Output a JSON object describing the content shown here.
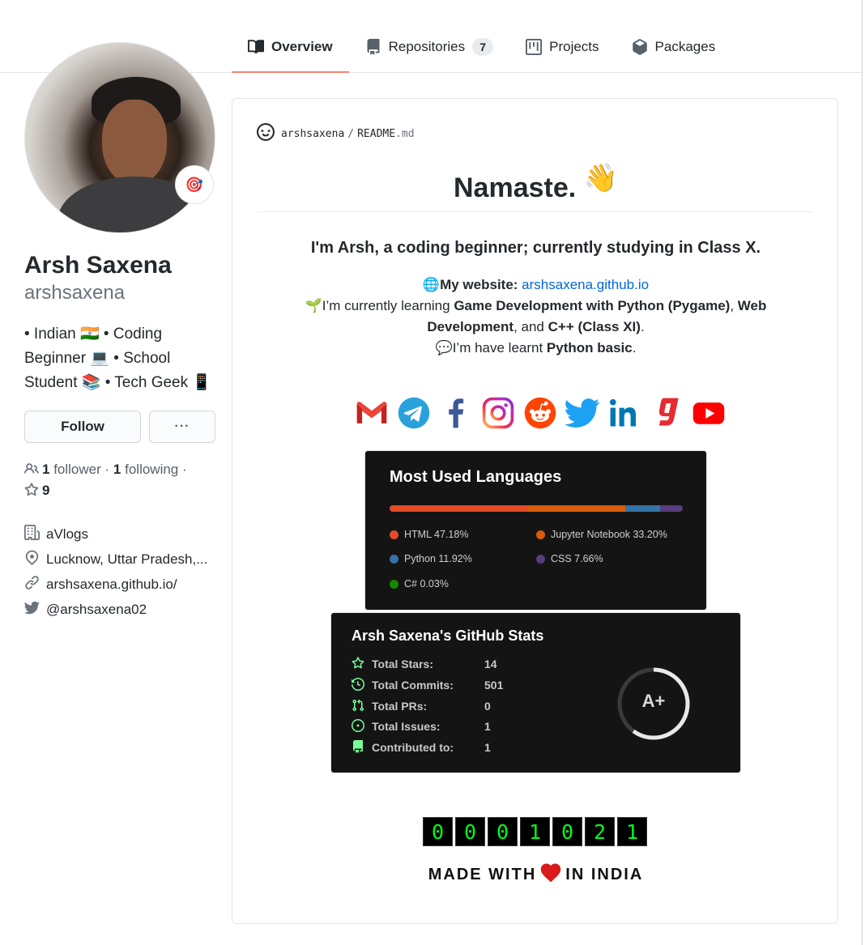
{
  "tabs": [
    {
      "label": "Overview",
      "icon": "book-icon",
      "selected": true
    },
    {
      "label": "Repositories",
      "icon": "repo-icon",
      "count": "7"
    },
    {
      "label": "Projects",
      "icon": "project-icon"
    },
    {
      "label": "Packages",
      "icon": "package-icon"
    }
  ],
  "profile": {
    "name": "Arsh Saxena",
    "username": "arshsaxena",
    "status_emoji": "🎯",
    "bio": "• Indian 🇮🇳 • Coding Beginner 💻 • School Student 📚 • Tech Geek 📱",
    "follow_label": "Follow",
    "more_label": "···",
    "followers_count": "1",
    "followers_label": "follower",
    "following_count": "1",
    "following_label": "following",
    "stars_count": "9",
    "organization": "aVlogs",
    "location": "Lucknow, Uttar Pradesh,...",
    "website": "arshsaxena.github.io/",
    "twitter": "@arshsaxena02"
  },
  "readme": {
    "owner": "arshsaxena",
    "separator": "/",
    "file_base": "README",
    "file_ext": ".md",
    "heading": "Namaste.",
    "heading_emoji": "👋",
    "intro": "I'm Arsh, a coding beginner; currently studying in Class X.",
    "website_prefix": "🌐My website: ",
    "website_link": "arshsaxena.github.io",
    "learning_prefix": "🌱I’m currently learning ",
    "learning_a": "Game Development with Python (Pygame)",
    "learning_sep": ", ",
    "learning_b": "Web Development",
    "learning_and": ", and ",
    "learning_c": "C++ (Class XI)",
    "learning_end": ".",
    "learnt_prefix": "💬I’m have learnt ",
    "learnt_bold": "Python basic",
    "learnt_end": ".",
    "socials": [
      "gmail-icon",
      "telegram-icon",
      "facebook-icon",
      "instagram-icon",
      "reddit-icon",
      "twitter-icon",
      "linkedin-icon",
      "gaana-icon",
      "youtube-icon"
    ],
    "languages_card": {
      "title": "Most Used Languages",
      "languages": [
        {
          "name": "HTML",
          "percent": 47.18,
          "label": "HTML 47.18%",
          "color": "#e34c26"
        },
        {
          "name": "Jupyter Notebook",
          "percent": 33.2,
          "label": "Jupyter Notebook 33.20%",
          "color": "#DA5B0B"
        },
        {
          "name": "Python",
          "percent": 11.92,
          "label": "Python 11.92%",
          "color": "#3572A5"
        },
        {
          "name": "CSS",
          "percent": 7.66,
          "label": "CSS 7.66%",
          "color": "#563d7c"
        },
        {
          "name": "C#",
          "percent": 0.03,
          "label": "C# 0.03%",
          "color": "#178600"
        }
      ]
    },
    "stats_card": {
      "title": "Arsh Saxena's GitHub Stats",
      "rows": [
        {
          "label": "Total Stars:",
          "value": "14",
          "icon": "star-icon"
        },
        {
          "label": "Total Commits:",
          "value": "501",
          "icon": "history-icon"
        },
        {
          "label": "Total PRs:",
          "value": "0",
          "icon": "pull-request-icon"
        },
        {
          "label": "Total Issues:",
          "value": "1",
          "icon": "issue-icon"
        },
        {
          "label": "Contributed to:",
          "value": "1",
          "icon": "repo-icon"
        }
      ],
      "rank": "A+",
      "rank_progress": 0.6,
      "accent_color": "#79ff97"
    },
    "visitor_digits": [
      "0",
      "0",
      "0",
      "1",
      "0",
      "2",
      "1"
    ],
    "made_with_prefix": "MADE WITH",
    "made_with_suffix": "IN INDIA",
    "heart_color": "#d91a1a"
  }
}
